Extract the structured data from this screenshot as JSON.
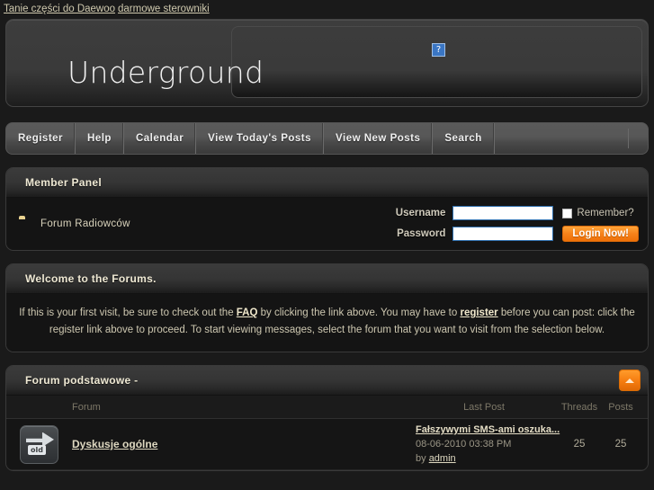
{
  "toplinks": [
    {
      "label": "Tanie części do Daewoo"
    },
    {
      "label": "darmowe sterowniki"
    }
  ],
  "header": {
    "logo": "Underground",
    "broken_image_glyph": "?"
  },
  "nav": {
    "items": [
      {
        "label": "Register"
      },
      {
        "label": "Help"
      },
      {
        "label": "Calendar"
      },
      {
        "label": "View Today's Posts"
      },
      {
        "label": "View New Posts"
      },
      {
        "label": "Search"
      }
    ]
  },
  "member_panel": {
    "title": "Member Panel",
    "forum_link": "Forum Radiowców",
    "username_label": "Username",
    "password_label": "Password",
    "username_value": "",
    "password_value": "",
    "remember_label": "Remember?",
    "login_button": "Login Now!"
  },
  "welcome": {
    "title": "Welcome to the Forums.",
    "text_part1": "If this is your first visit, be sure to check out the ",
    "faq_link": "FAQ",
    "text_part2": " by clicking the link above. You may have to ",
    "register_link": "register",
    "text_part3": " before you can post: click the register link above to proceed. To start viewing messages, select the forum that you want to visit from the selection below."
  },
  "forum_section": {
    "title": "Forum podstawowe -",
    "columns": {
      "forum": "Forum",
      "last_post": "Last Post",
      "threads": "Threads",
      "posts": "Posts"
    },
    "rows": [
      {
        "icon": "old-forum-icon",
        "icon_label": "old",
        "name": "Dyskusje ogólne",
        "last_post_title": "Fałszywymi SMS-ami oszuka...",
        "last_post_date": "08-06-2010 03:38 PM",
        "last_post_by_prefix": "by ",
        "last_post_author": "admin",
        "threads": "25",
        "posts": "25"
      }
    ]
  },
  "colors": {
    "page_bg": "#1a1a1a",
    "panel_bg": "#141414",
    "accent_orange": "#f7821a",
    "link_tan": "#cfc9ae",
    "input_border_blue": "#2f6fae"
  }
}
